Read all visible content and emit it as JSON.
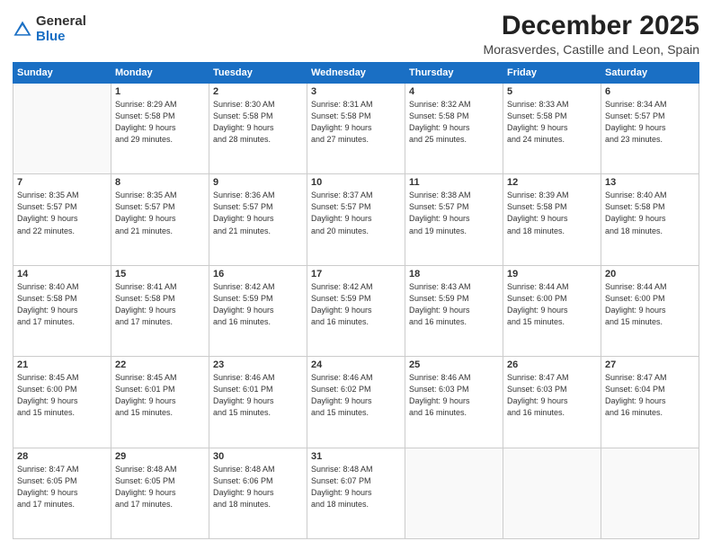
{
  "logo": {
    "general": "General",
    "blue": "Blue"
  },
  "title": "December 2025",
  "subtitle": "Morasverdes, Castille and Leon, Spain",
  "weekdays": [
    "Sunday",
    "Monday",
    "Tuesday",
    "Wednesday",
    "Thursday",
    "Friday",
    "Saturday"
  ],
  "weeks": [
    [
      {
        "day": "",
        "info": ""
      },
      {
        "day": "1",
        "info": "Sunrise: 8:29 AM\nSunset: 5:58 PM\nDaylight: 9 hours\nand 29 minutes."
      },
      {
        "day": "2",
        "info": "Sunrise: 8:30 AM\nSunset: 5:58 PM\nDaylight: 9 hours\nand 28 minutes."
      },
      {
        "day": "3",
        "info": "Sunrise: 8:31 AM\nSunset: 5:58 PM\nDaylight: 9 hours\nand 27 minutes."
      },
      {
        "day": "4",
        "info": "Sunrise: 8:32 AM\nSunset: 5:58 PM\nDaylight: 9 hours\nand 25 minutes."
      },
      {
        "day": "5",
        "info": "Sunrise: 8:33 AM\nSunset: 5:58 PM\nDaylight: 9 hours\nand 24 minutes."
      },
      {
        "day": "6",
        "info": "Sunrise: 8:34 AM\nSunset: 5:57 PM\nDaylight: 9 hours\nand 23 minutes."
      }
    ],
    [
      {
        "day": "7",
        "info": "Sunrise: 8:35 AM\nSunset: 5:57 PM\nDaylight: 9 hours\nand 22 minutes."
      },
      {
        "day": "8",
        "info": "Sunrise: 8:35 AM\nSunset: 5:57 PM\nDaylight: 9 hours\nand 21 minutes."
      },
      {
        "day": "9",
        "info": "Sunrise: 8:36 AM\nSunset: 5:57 PM\nDaylight: 9 hours\nand 21 minutes."
      },
      {
        "day": "10",
        "info": "Sunrise: 8:37 AM\nSunset: 5:57 PM\nDaylight: 9 hours\nand 20 minutes."
      },
      {
        "day": "11",
        "info": "Sunrise: 8:38 AM\nSunset: 5:57 PM\nDaylight: 9 hours\nand 19 minutes."
      },
      {
        "day": "12",
        "info": "Sunrise: 8:39 AM\nSunset: 5:58 PM\nDaylight: 9 hours\nand 18 minutes."
      },
      {
        "day": "13",
        "info": "Sunrise: 8:40 AM\nSunset: 5:58 PM\nDaylight: 9 hours\nand 18 minutes."
      }
    ],
    [
      {
        "day": "14",
        "info": "Sunrise: 8:40 AM\nSunset: 5:58 PM\nDaylight: 9 hours\nand 17 minutes."
      },
      {
        "day": "15",
        "info": "Sunrise: 8:41 AM\nSunset: 5:58 PM\nDaylight: 9 hours\nand 17 minutes."
      },
      {
        "day": "16",
        "info": "Sunrise: 8:42 AM\nSunset: 5:59 PM\nDaylight: 9 hours\nand 16 minutes."
      },
      {
        "day": "17",
        "info": "Sunrise: 8:42 AM\nSunset: 5:59 PM\nDaylight: 9 hours\nand 16 minutes."
      },
      {
        "day": "18",
        "info": "Sunrise: 8:43 AM\nSunset: 5:59 PM\nDaylight: 9 hours\nand 16 minutes."
      },
      {
        "day": "19",
        "info": "Sunrise: 8:44 AM\nSunset: 6:00 PM\nDaylight: 9 hours\nand 15 minutes."
      },
      {
        "day": "20",
        "info": "Sunrise: 8:44 AM\nSunset: 6:00 PM\nDaylight: 9 hours\nand 15 minutes."
      }
    ],
    [
      {
        "day": "21",
        "info": "Sunrise: 8:45 AM\nSunset: 6:00 PM\nDaylight: 9 hours\nand 15 minutes."
      },
      {
        "day": "22",
        "info": "Sunrise: 8:45 AM\nSunset: 6:01 PM\nDaylight: 9 hours\nand 15 minutes."
      },
      {
        "day": "23",
        "info": "Sunrise: 8:46 AM\nSunset: 6:01 PM\nDaylight: 9 hours\nand 15 minutes."
      },
      {
        "day": "24",
        "info": "Sunrise: 8:46 AM\nSunset: 6:02 PM\nDaylight: 9 hours\nand 15 minutes."
      },
      {
        "day": "25",
        "info": "Sunrise: 8:46 AM\nSunset: 6:03 PM\nDaylight: 9 hours\nand 16 minutes."
      },
      {
        "day": "26",
        "info": "Sunrise: 8:47 AM\nSunset: 6:03 PM\nDaylight: 9 hours\nand 16 minutes."
      },
      {
        "day": "27",
        "info": "Sunrise: 8:47 AM\nSunset: 6:04 PM\nDaylight: 9 hours\nand 16 minutes."
      }
    ],
    [
      {
        "day": "28",
        "info": "Sunrise: 8:47 AM\nSunset: 6:05 PM\nDaylight: 9 hours\nand 17 minutes."
      },
      {
        "day": "29",
        "info": "Sunrise: 8:48 AM\nSunset: 6:05 PM\nDaylight: 9 hours\nand 17 minutes."
      },
      {
        "day": "30",
        "info": "Sunrise: 8:48 AM\nSunset: 6:06 PM\nDaylight: 9 hours\nand 18 minutes."
      },
      {
        "day": "31",
        "info": "Sunrise: 8:48 AM\nSunset: 6:07 PM\nDaylight: 9 hours\nand 18 minutes."
      },
      {
        "day": "",
        "info": ""
      },
      {
        "day": "",
        "info": ""
      },
      {
        "day": "",
        "info": ""
      }
    ]
  ]
}
